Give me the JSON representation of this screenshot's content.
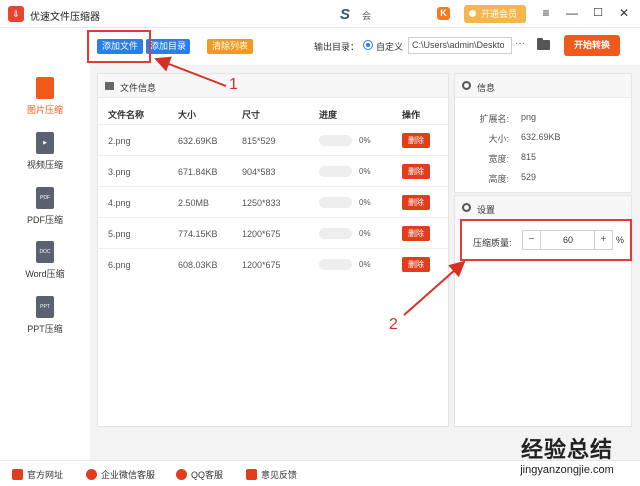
{
  "titlebar": {
    "app_title": "优速文件压缩器",
    "user_label": "会",
    "vip_label": "开通会员",
    "min_symbol": "—",
    "max_symbol": "☐",
    "close_symbol": "✕",
    "menu_symbol": "≡"
  },
  "toolbar": {
    "add_file": "添加文件",
    "add_dir": "添加目录",
    "clear_list": "清除列表",
    "output_label": "输出目录：",
    "radio_label": "自定义",
    "output_path": "C:\\Users\\admin\\Deskto",
    "browse": "···",
    "start": "开始转换"
  },
  "sidebar": {
    "items": [
      {
        "label": "图片压缩",
        "icon": "image-icon",
        "active": true
      },
      {
        "label": "视频压缩",
        "icon": "video-icon",
        "active": false
      },
      {
        "label": "PDF压缩",
        "icon": "pdf-icon",
        "active": false
      },
      {
        "label": "Word压缩",
        "icon": "word-icon",
        "active": false
      },
      {
        "label": "PPT压缩",
        "icon": "ppt-icon",
        "active": false
      }
    ],
    "icon_tags": [
      "",
      "▶",
      "PDF",
      "DOC",
      "PPT"
    ]
  },
  "file_panel": {
    "title": "文件信息",
    "columns": [
      "文件名称",
      "大小",
      "尺寸",
      "进度",
      "操作"
    ],
    "rows": [
      {
        "name": "2.png",
        "size": "632.69KB",
        "dim": "815*529",
        "progress": 0,
        "pct": "0%",
        "action": "删除"
      },
      {
        "name": "3.png",
        "size": "671.84KB",
        "dim": "904*583",
        "progress": 0,
        "pct": "0%",
        "action": "删除"
      },
      {
        "name": "4.png",
        "size": "2.50MB",
        "dim": "1250*833",
        "progress": 0,
        "pct": "0%",
        "action": "删除"
      },
      {
        "name": "5.png",
        "size": "774.15KB",
        "dim": "1200*675",
        "progress": 0,
        "pct": "0%",
        "action": "删除"
      },
      {
        "name": "6.png",
        "size": "608.03KB",
        "dim": "1200*675",
        "progress": 0,
        "pct": "0%",
        "action": "删除"
      }
    ]
  },
  "info_panel": {
    "title": "信息",
    "fields": [
      {
        "key": "扩展名:",
        "value": "png"
      },
      {
        "key": "大小:",
        "value": "632.69KB"
      },
      {
        "key": "宽度:",
        "value": "815"
      },
      {
        "key": "高度:",
        "value": "529"
      }
    ]
  },
  "settings_panel": {
    "title": "设置",
    "quality_label": "压缩质量:",
    "quality_value": "60",
    "minus": "−",
    "plus": "+",
    "unit": "%"
  },
  "annotations": {
    "label_1": "1",
    "label_2": "2",
    "color": "#d93025"
  },
  "bottombar": {
    "items": [
      "官方网址",
      "企业微信客服",
      "QQ客服",
      "意见反馈"
    ]
  },
  "watermark": {
    "cn": "经验总结",
    "en": "jingyanzongjie.com"
  },
  "colors": {
    "accent_blue": "#2b7de9",
    "accent_orange": "#f25a1c",
    "delete_red": "#e03d1c",
    "clear_orange": "#f29a1d",
    "vip_gold": "#f4b64d"
  }
}
